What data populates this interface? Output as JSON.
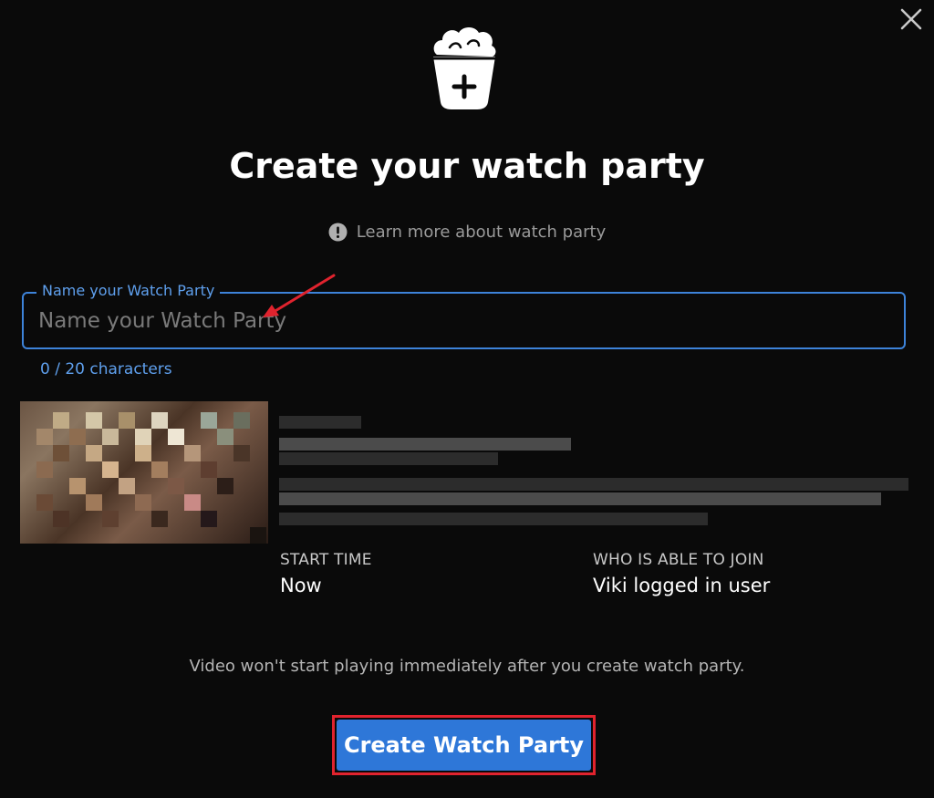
{
  "dialog": {
    "title": "Create your watch party",
    "learn_more": "Learn more about watch party",
    "close_icon": "close-icon",
    "logo_icon": "popcorn-bucket-plus-icon",
    "info_icon": "exclamation-circle-icon"
  },
  "name_field": {
    "label": "Name your Watch Party",
    "placeholder": "Name your Watch Party",
    "value": "",
    "char_count": "0 / 20 characters"
  },
  "details": {
    "start_time_label": "START TIME",
    "start_time_value": "Now",
    "who_label": "WHO IS ABLE TO JOIN",
    "who_value": "Viki logged in user"
  },
  "notice": "Video won't start playing immediately after you create watch party.",
  "cta": {
    "label": "Create Watch Party"
  },
  "colors": {
    "accent": "#3d83d9",
    "button": "#2e77d8",
    "highlight": "#e0232e",
    "background": "#0a0a0a"
  }
}
